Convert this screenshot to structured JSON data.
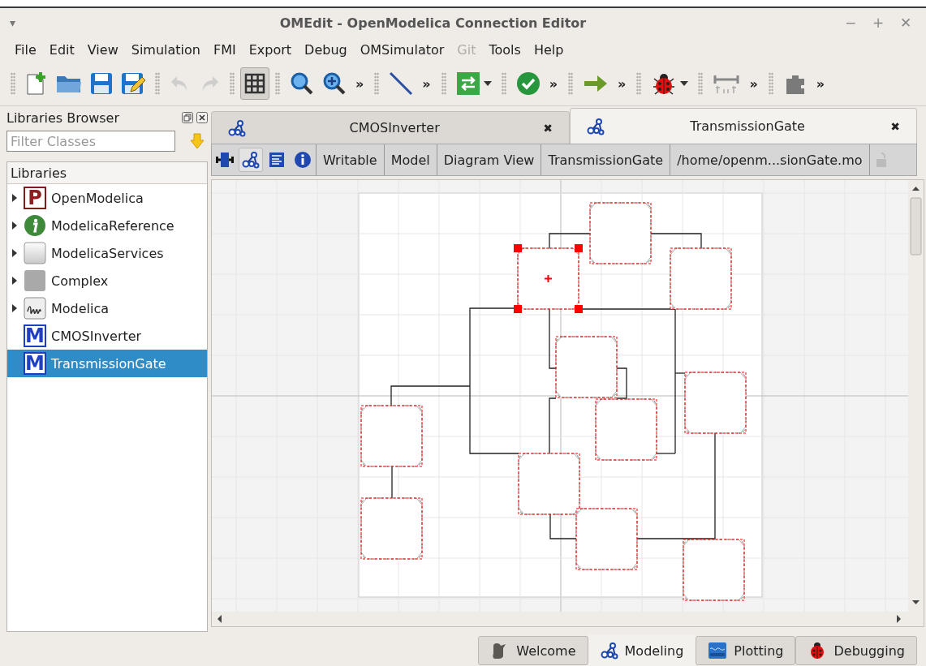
{
  "window": {
    "menu_glyph": "▾",
    "title": "OMEdit - OpenModelica Connection Editor",
    "controls": [
      "−",
      "+",
      "✕"
    ]
  },
  "menu": [
    {
      "label": "File",
      "disabled": false
    },
    {
      "label": "Edit",
      "disabled": false
    },
    {
      "label": "View",
      "disabled": false
    },
    {
      "label": "Simulation",
      "disabled": false
    },
    {
      "label": "FMI",
      "disabled": false
    },
    {
      "label": "Export",
      "disabled": false
    },
    {
      "label": "Debug",
      "disabled": false
    },
    {
      "label": "OMSimulator",
      "disabled": false
    },
    {
      "label": "Git",
      "disabled": true
    },
    {
      "label": "Tools",
      "disabled": false
    },
    {
      "label": "Help",
      "disabled": false
    }
  ],
  "toolbar": [
    {
      "buttons": [
        {
          "kind": "button",
          "disabled": false
        },
        {
          "kind": "button",
          "disabled": false
        },
        {
          "kind": "button",
          "disabled": false
        },
        {
          "kind": "button",
          "disabled": false
        }
      ]
    },
    {
      "buttons": [
        {
          "kind": "button",
          "disabled": true
        },
        {
          "kind": "button",
          "disabled": true
        }
      ]
    },
    {
      "buttons": [
        {
          "kind": "toggle",
          "disabled": false,
          "pressed": true
        }
      ]
    },
    {
      "buttons": [
        {
          "kind": "button",
          "disabled": false
        },
        {
          "kind": "button",
          "disabled": false
        }
      ],
      "overflow": "»"
    },
    {
      "buttons": [
        {
          "kind": "button",
          "disabled": false
        }
      ],
      "overflow": "»"
    },
    {
      "buttons": [
        {
          "kind": "menu",
          "disabled": false
        }
      ]
    },
    {
      "buttons": [
        {
          "kind": "button",
          "disabled": false
        }
      ],
      "overflow": "»"
    },
    {
      "buttons": [
        {
          "kind": "button",
          "disabled": false
        }
      ],
      "overflow": "»"
    },
    {
      "buttons": [
        {
          "kind": "menu",
          "disabled": false
        }
      ]
    },
    {
      "buttons": [
        {
          "kind": "button",
          "disabled": false
        }
      ],
      "overflow": "»"
    },
    {
      "buttons": [
        {
          "kind": "button",
          "disabled": false
        }
      ],
      "overflow": "»"
    }
  ],
  "libraries_browser": {
    "title": "Libraries Browser",
    "filter": {
      "placeholder": "Filter Classes"
    },
    "header": "Libraries",
    "items": [
      {
        "label": "OpenModelica",
        "kind": "package",
        "glyph": "P",
        "expandable": true,
        "expanded": false,
        "selected": false
      },
      {
        "label": "ModelicaReference",
        "kind": "info",
        "expandable": true,
        "expanded": false,
        "selected": false
      },
      {
        "label": "ModelicaServices",
        "kind": "gradient",
        "expandable": true,
        "expanded": false,
        "selected": false
      },
      {
        "label": "Complex",
        "kind": "plain",
        "expandable": true,
        "expanded": false,
        "selected": false
      },
      {
        "label": "Modelica",
        "kind": "library",
        "expandable": true,
        "expanded": false,
        "selected": false
      },
      {
        "label": "CMOSInverter",
        "kind": "model",
        "glyph": "M",
        "expandable": false,
        "selected": false
      },
      {
        "label": "TransmissionGate",
        "kind": "model",
        "glyph": "M",
        "expandable": false,
        "selected": true
      }
    ]
  },
  "document_tabs": [
    {
      "label": "CMOSInverter",
      "close": "✖",
      "selected": false
    },
    {
      "label": "TransmissionGate",
      "close": "✖",
      "selected": true
    }
  ],
  "view_toolbar": {
    "views": [
      {
        "selected": false
      },
      {
        "selected": true
      },
      {
        "selected": false
      },
      {
        "selected": false
      }
    ],
    "fields": [
      "Writable",
      "Model",
      "Diagram View",
      "TransmissionGate",
      "/home/openm...sionGate.mo"
    ]
  },
  "diagram": {
    "components": [
      {
        "selected": false
      },
      {
        "selected": true
      },
      {
        "selected": false
      },
      {
        "selected": false
      },
      {
        "selected": false
      },
      {
        "selected": false
      },
      {
        "selected": false
      },
      {
        "selected": false
      },
      {
        "selected": false
      },
      {
        "selected": false
      },
      {
        "selected": false
      }
    ]
  },
  "perspectives": [
    {
      "label": "Welcome",
      "selected": false
    },
    {
      "label": "Modeling",
      "selected": true
    },
    {
      "label": "Plotting",
      "selected": false
    },
    {
      "label": "Debugging",
      "selected": false
    }
  ]
}
